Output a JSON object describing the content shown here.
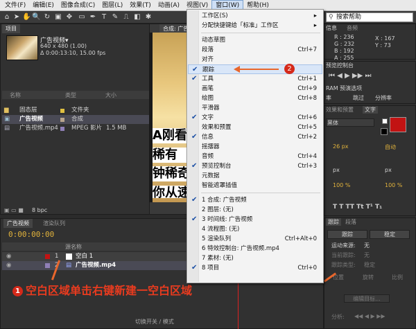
{
  "menubar": {
    "items": [
      "文件(F)",
      "编辑(E)",
      "图像合成(C)",
      "图层(L)",
      "效果(T)",
      "动画(A)",
      "视图(V)",
      "窗口(W)",
      "帮助(H)"
    ],
    "active_index": 7
  },
  "search": {
    "placeholder": "搜索帮助"
  },
  "project": {
    "tab": "项目",
    "comp_name": "广告视频▾",
    "comp_res": "640 x 480 (1.00)",
    "comp_dur": "Δ 0:00:13:10, 15.00 fps",
    "headers": [
      "名称",
      "类型",
      "大小"
    ],
    "rows": [
      {
        "name": "固态层",
        "type": "文件夹",
        "size": ""
      },
      {
        "name": "广告视频",
        "type": "合成",
        "size": ""
      },
      {
        "name": "广告视频.mp4",
        "type": "MPEG 影片",
        "size": "1.5 MB"
      }
    ],
    "bpc": "8 bpc"
  },
  "comp_tab": "合成: 广告视频",
  "chinese_overlay": [
    "A刚看",
    "稀有",
    "钟稀奇",
    "你从速"
  ],
  "timeline": {
    "tabs": [
      "广告视频",
      "渲染队列"
    ],
    "time": "0:00:00:00",
    "col_label": "源名称",
    "layers": [
      {
        "num": "1",
        "name": "空白 1"
      },
      {
        "num": "2",
        "name": "广告视频.mp4"
      }
    ],
    "footer": "切换开关 / 模式"
  },
  "annotation1": {
    "num": "1",
    "text": "空白区域单击右键新建一空白区域"
  },
  "annotation2": {
    "num": "2"
  },
  "dropdown": {
    "items": [
      {
        "label": "工作区(S)",
        "shortcut": "▸",
        "checked": false
      },
      {
        "label": "分配快捷键给「标准」工作区",
        "shortcut": "▸",
        "checked": false
      },
      {
        "sep": true
      },
      {
        "label": "动态草图",
        "shortcut": "",
        "checked": false
      },
      {
        "label": "段落",
        "shortcut": "Ctrl+7",
        "checked": false
      },
      {
        "label": "对齐",
        "shortcut": "",
        "checked": false
      },
      {
        "label": "跟踪",
        "shortcut": "",
        "checked": true,
        "hl": true
      },
      {
        "label": "工具",
        "shortcut": "Ctrl+1",
        "checked": true
      },
      {
        "label": "画笔",
        "shortcut": "Ctrl+9",
        "checked": false
      },
      {
        "label": "绘图",
        "shortcut": "Ctrl+8",
        "checked": false
      },
      {
        "label": "平滑器",
        "shortcut": "",
        "checked": false
      },
      {
        "label": "文字",
        "shortcut": "Ctrl+6",
        "checked": true
      },
      {
        "label": "效果和预置",
        "shortcut": "Ctrl+5",
        "checked": false
      },
      {
        "label": "信息",
        "shortcut": "Ctrl+2",
        "checked": true
      },
      {
        "label": "摇摆器",
        "shortcut": "",
        "checked": false
      },
      {
        "label": "音频",
        "shortcut": "Ctrl+4",
        "checked": false
      },
      {
        "label": "预览控制台",
        "shortcut": "Ctrl+3",
        "checked": true
      },
      {
        "label": "元数据",
        "shortcut": "",
        "checked": false
      },
      {
        "label": "智能遮罩插值",
        "shortcut": "",
        "checked": false
      },
      {
        "sep": true
      },
      {
        "label": "1 合成: 广告视频",
        "shortcut": "",
        "checked": true
      },
      {
        "label": "2 图层: (无)",
        "shortcut": "",
        "checked": false
      },
      {
        "label": "3 时间线: 广告视频",
        "shortcut": "",
        "checked": true
      },
      {
        "label": "4 流程图: (无)",
        "shortcut": "",
        "checked": false
      },
      {
        "label": "5 渲染队列",
        "shortcut": "Ctrl+Alt+0",
        "checked": false
      },
      {
        "label": "6 特效控制台: 广告视频.mp4",
        "shortcut": "",
        "checked": false
      },
      {
        "label": "7 素材: (无)",
        "shortcut": "",
        "checked": false
      },
      {
        "label": "8 项目",
        "shortcut": "Ctrl+0",
        "checked": true
      }
    ]
  },
  "right": {
    "info_tabs": [
      "信息",
      "音频"
    ],
    "r": "R : 236",
    "g": "G : 232",
    "b": "B : 192",
    "a": "A : 255",
    "x": "X : 167",
    "y": "Y : 73",
    "preview_tab": "预览控制台",
    "ram": "RAM 预演选项",
    "ram_labels": [
      "率",
      "跳过",
      "分辨率"
    ],
    "text_tabs": [
      "效果和预置",
      "文字"
    ],
    "font": "黑体",
    "size": "26 px",
    "auto": "自动",
    "px1": "px",
    "px2": "px",
    "pct1": "100 %",
    "pct2": "100 %",
    "tracker_tabs": [
      "跟踪",
      "段落"
    ],
    "track_btns": [
      "跟踪",
      "稳定"
    ],
    "motion_src": "运动来源:",
    "motion_src_val": "无",
    "cur_track": "当前跟踪:",
    "cur_val": "无",
    "track_type": "跟踪类型:",
    "type_val": "稳定",
    "checks": [
      "位置",
      "旋转",
      "比例"
    ],
    "edit_target": "编辑目标...",
    "analyze": "分析:"
  }
}
